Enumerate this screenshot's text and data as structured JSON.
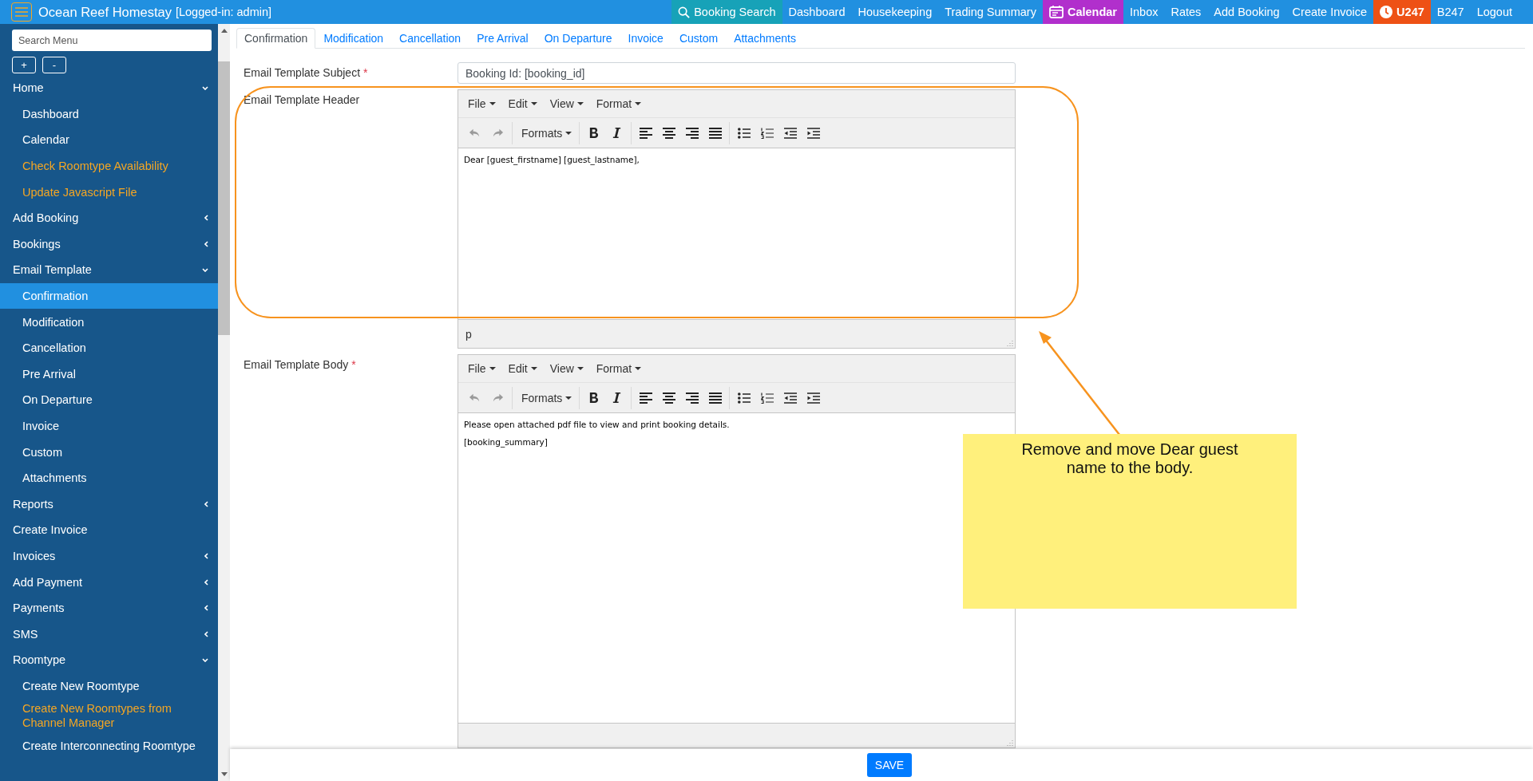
{
  "app": {
    "title": "Ocean Reef Homestay",
    "login": "[Logged-in: admin]"
  },
  "nav": [
    {
      "label": "Booking Search",
      "kind": "search",
      "bold": false,
      "color": "#17a2b8"
    },
    {
      "label": "Dashboard",
      "bold": false
    },
    {
      "label": "Housekeeping",
      "bold": false
    },
    {
      "label": "Trading Summary",
      "bold": false
    },
    {
      "label": "Calendar",
      "kind": "calendar",
      "bold": true,
      "color": "#b12fcc"
    },
    {
      "label": "Inbox",
      "bold": false
    },
    {
      "label": "Rates",
      "bold": false
    },
    {
      "label": "Add Booking",
      "bold": false
    },
    {
      "label": "Create Invoice",
      "bold": false
    },
    {
      "label": "U247",
      "kind": "clock",
      "bold": true,
      "color": "#ee5115"
    },
    {
      "label": "B247",
      "bold": false
    },
    {
      "label": "Logout",
      "bold": false
    }
  ],
  "sidebar": {
    "search": {
      "placeholder": "Search Menu"
    },
    "expand_all": "+",
    "collapse_all": "-",
    "items": [
      {
        "label": "Home",
        "expanded": true,
        "selected": false,
        "children": [
          {
            "label": "Dashboard",
            "selected": false,
            "color": "#ffffff"
          },
          {
            "label": "Calendar",
            "selected": false,
            "color": "#ffffff"
          },
          {
            "label": "Check Roomtype Availability",
            "selected": false,
            "color": "#f5a623"
          },
          {
            "label": "Update Javascript File",
            "selected": false,
            "color": "#f5a623"
          }
        ]
      },
      {
        "label": "Add Booking",
        "expanded": false,
        "selected": false
      },
      {
        "label": "Bookings",
        "expanded": false,
        "selected": false
      },
      {
        "label": "Email Template",
        "expanded": true,
        "selected": false,
        "children": [
          {
            "label": "Confirmation",
            "selected": true,
            "color": "#ffffff"
          },
          {
            "label": "Modification",
            "selected": false,
            "color": "#ffffff"
          },
          {
            "label": "Cancellation",
            "selected": false,
            "color": "#ffffff"
          },
          {
            "label": "Pre Arrival",
            "selected": false,
            "color": "#ffffff"
          },
          {
            "label": "On Departure",
            "selected": false,
            "color": "#ffffff"
          },
          {
            "label": "Invoice",
            "selected": false,
            "color": "#ffffff"
          },
          {
            "label": "Custom",
            "selected": false,
            "color": "#ffffff"
          },
          {
            "label": "Attachments",
            "selected": false,
            "color": "#ffffff"
          }
        ]
      },
      {
        "label": "Reports",
        "expanded": false,
        "selected": false
      },
      {
        "label": "Create Invoice",
        "selected": false
      },
      {
        "label": "Invoices",
        "expanded": false,
        "selected": false
      },
      {
        "label": "Add Payment",
        "expanded": false,
        "selected": false
      },
      {
        "label": "Payments",
        "expanded": false,
        "selected": false
      },
      {
        "label": "SMS",
        "expanded": false,
        "selected": false
      },
      {
        "label": "Roomtype",
        "expanded": true,
        "selected": false,
        "children": [
          {
            "label": "Create New Roomtype",
            "selected": false,
            "color": "#ffffff"
          },
          {
            "label": "Create New Roomtypes from Channel Manager",
            "selected": false,
            "color": "#f5a623"
          },
          {
            "label": "Create Interconnecting Roomtype",
            "selected": false,
            "color": "#ffffff"
          }
        ]
      }
    ]
  },
  "tabs": [
    {
      "label": "Confirmation",
      "selected": true
    },
    {
      "label": "Modification",
      "selected": false
    },
    {
      "label": "Cancellation",
      "selected": false
    },
    {
      "label": "Pre Arrival",
      "selected": false
    },
    {
      "label": "On Departure",
      "selected": false
    },
    {
      "label": "Invoice",
      "selected": false
    },
    {
      "label": "Custom",
      "selected": false
    },
    {
      "label": "Attachments",
      "selected": false
    }
  ],
  "form": {
    "fields": [
      {
        "kind": "text",
        "label": "Email Template Subject",
        "required_mark": "*",
        "value": "Booking Id: [booking_id]"
      },
      {
        "kind": "editor",
        "label": "Email Template Header",
        "menus": [
          "File",
          "Edit",
          "View",
          "Format"
        ],
        "tools": [
          {
            "kind": "undo",
            "disabled": true
          },
          {
            "kind": "redo",
            "disabled": true
          },
          {
            "kind": "formats",
            "label": "Formats",
            "disabled": false
          },
          {
            "kind": "bold",
            "disabled": false
          },
          {
            "kind": "italic",
            "disabled": false
          },
          {
            "kind": "align-left",
            "disabled": false
          },
          {
            "kind": "align-center",
            "disabled": false
          },
          {
            "kind": "align-right",
            "disabled": false
          },
          {
            "kind": "justify",
            "disabled": false
          },
          {
            "kind": "bullet-list",
            "disabled": false
          },
          {
            "kind": "numbered-list",
            "disabled": false
          },
          {
            "kind": "outdent",
            "disabled": false
          },
          {
            "kind": "indent",
            "disabled": false
          }
        ],
        "content": [
          "Dear [guest_firstname] [guest_lastname],"
        ],
        "path": "p"
      },
      {
        "kind": "editor",
        "label": "Email Template Body",
        "required_mark": "*",
        "menus": [
          "File",
          "Edit",
          "View",
          "Format"
        ],
        "tools": [
          {
            "kind": "undo",
            "disabled": true
          },
          {
            "kind": "redo",
            "disabled": true
          },
          {
            "kind": "formats",
            "label": "Formats",
            "disabled": false
          },
          {
            "kind": "bold",
            "disabled": false
          },
          {
            "kind": "italic",
            "disabled": false
          },
          {
            "kind": "align-left",
            "disabled": false
          },
          {
            "kind": "align-center",
            "disabled": false
          },
          {
            "kind": "align-right",
            "disabled": false
          },
          {
            "kind": "justify",
            "disabled": false
          },
          {
            "kind": "bullet-list",
            "disabled": false
          },
          {
            "kind": "numbered-list",
            "disabled": false
          },
          {
            "kind": "outdent",
            "disabled": false
          },
          {
            "kind": "indent",
            "disabled": false
          }
        ],
        "content": [
          "Please open attached pdf file to view and print booking details.",
          "[booking_summary]"
        ]
      }
    ]
  },
  "save": "SAVE",
  "note": {
    "text": "Remove and move Dear guest name to the body."
  }
}
